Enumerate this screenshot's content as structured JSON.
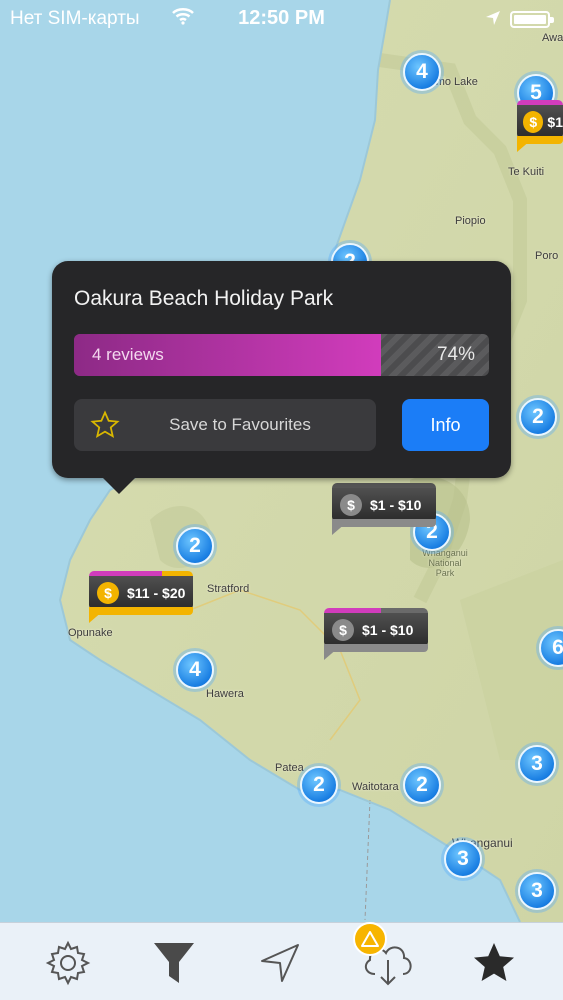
{
  "status_bar": {
    "carrier": "Нет SIM-карты",
    "time": "12:50 PM"
  },
  "map": {
    "place_labels": [
      "Waitomo Lake",
      "Awa",
      "Te Kuiti",
      "Piopio",
      "Poro",
      "Stratford",
      "Opunake",
      "Hawera",
      "Whanganui National Park",
      "Patea",
      "Waitotara",
      "Whanganui"
    ],
    "clusters": [
      "4",
      "5",
      "2",
      "2",
      "2",
      "2",
      "4",
      "6",
      "2",
      "2",
      "3",
      "3",
      "3"
    ],
    "price_pins": [
      {
        "price": "$11 - $20",
        "coin": "$",
        "color": "#f3b400"
      },
      {
        "price": "$1 -  $10",
        "coin": "$",
        "color": "#8a8a8a"
      },
      {
        "price": "$1 -  $10",
        "coin": "$",
        "color": "#8a8a8a"
      },
      {
        "price": "$1",
        "coin": "$",
        "color": "#f3b400"
      }
    ]
  },
  "popup": {
    "title": "Oakura Beach Holiday Park",
    "reviews": "4 reviews",
    "percent": "74%",
    "rating_value": 0.74,
    "save_label": "Save to Favourites",
    "info_label": "Info"
  },
  "tabbar": {
    "items": [
      "gear-icon",
      "filter-icon",
      "location-arrow-icon",
      "cloud-download-icon",
      "star-icon"
    ],
    "active_color": "#2a2a2a"
  }
}
